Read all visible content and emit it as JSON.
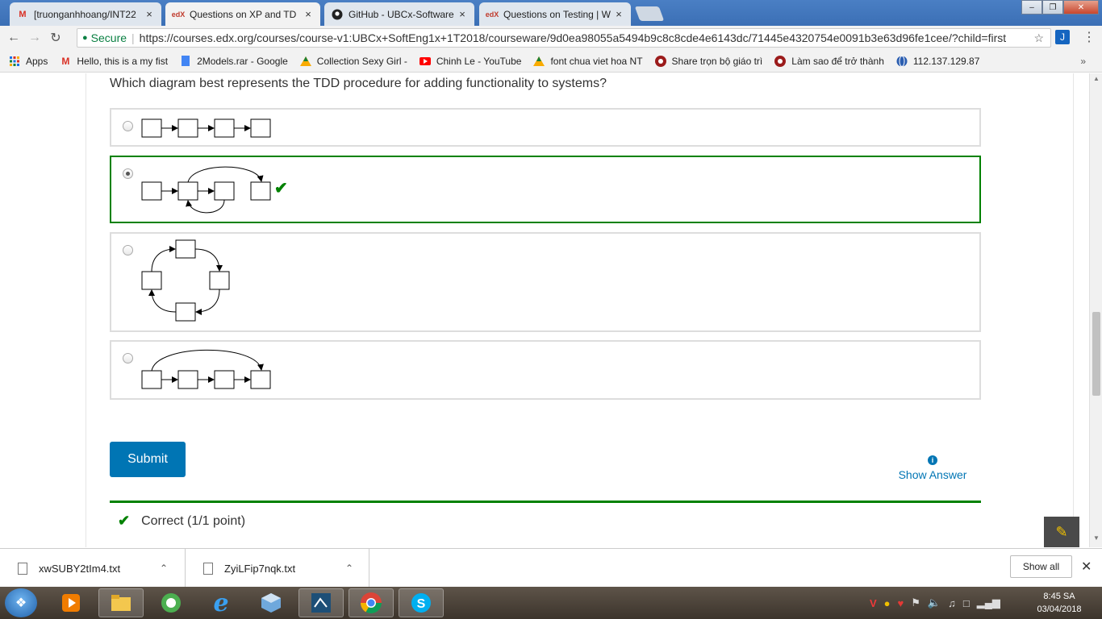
{
  "browser": {
    "tabs": [
      {
        "favicon": "M",
        "title": "[truonganhhoang/INT22",
        "close": "×"
      },
      {
        "favicon": "edX",
        "title": "Questions on XP and TD",
        "close": "×"
      },
      {
        "favicon": "github-icon",
        "title": "GitHub - UBCx-Software",
        "close": "×"
      },
      {
        "favicon": "edX",
        "title": "Questions on Testing | W",
        "close": "×"
      }
    ],
    "window_controls": {
      "minimize": "–",
      "maximize": "❐",
      "close": "✕"
    },
    "nav": {
      "back": "←",
      "forward": "→",
      "reload": "↻"
    },
    "omnibox": {
      "secure_label": "Secure",
      "url": "https://courses.edx.org/courses/course-v1:UBCx+SoftEng1x+1T2018/courseware/9d0ea98055a5494b9c8c8cde4e6143dc/71445e4320754e0091b3e63d96fe1cee/?child=first"
    },
    "bookmarks": [
      {
        "label": "Apps",
        "icon": "apps-grid-icon"
      },
      {
        "label": "Hello, this is a my fist",
        "icon": "gmail-icon"
      },
      {
        "label": "2Models.rar - Google",
        "icon": "file-icon"
      },
      {
        "label": "Collection Sexy Girl -",
        "icon": "drive-icon"
      },
      {
        "label": "Chinh Le - YouTube",
        "icon": "youtube-icon"
      },
      {
        "label": "font chua viet hoa NT",
        "icon": "drive-icon"
      },
      {
        "label": "Share trọn bộ giáo trì",
        "icon": "hub-icon"
      },
      {
        "label": "Làm sao để trở thành",
        "icon": "hub-icon"
      },
      {
        "label": "112.137.129.87",
        "icon": "globe-icon"
      }
    ],
    "bookmarks_overflow": "»"
  },
  "problem": {
    "question": "Which diagram best represents the TDD procedure for adding functionality to systems?",
    "selected_option": 2,
    "submit_label": "Submit",
    "show_answer_label": "Show Answer",
    "result_label": "Correct (1/1 point)"
  },
  "downloads": {
    "files": [
      {
        "name": "xwSUBY2tIm4.txt"
      },
      {
        "name": "ZyiLFip7nqk.txt"
      }
    ],
    "show_all_label": "Show all"
  },
  "taskbar": {
    "time": "8:45 SA",
    "date": "03/04/2018"
  },
  "colors": {
    "accent": "#0075b4",
    "correct": "#008100"
  }
}
